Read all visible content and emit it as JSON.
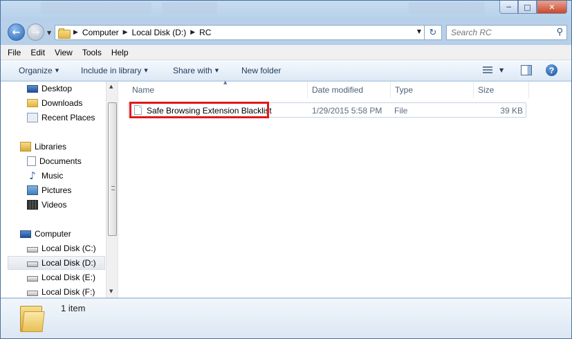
{
  "window": {
    "minimize": "─",
    "maximize": "□",
    "close": "✕"
  },
  "nav": {
    "back_icon": "arrow-left-icon",
    "forward_icon": "arrow-right-icon",
    "breadcrumb": [
      "Computer",
      "Local Disk (D:)",
      "RC"
    ],
    "search_placeholder": "Search RC"
  },
  "menu": [
    "File",
    "Edit",
    "View",
    "Tools",
    "Help"
  ],
  "toolbar": {
    "organize": "Organize",
    "include_in_library": "Include in library",
    "share_with": "Share with",
    "new_folder": "New folder"
  },
  "sidebar": {
    "favorites": [
      {
        "label": "Desktop",
        "icon": "desktop-icon"
      },
      {
        "label": "Downloads",
        "icon": "downloads-folder-icon"
      },
      {
        "label": "Recent Places",
        "icon": "recent-places-icon"
      }
    ],
    "libraries_label": "Libraries",
    "libraries": [
      {
        "label": "Documents",
        "icon": "documents-icon"
      },
      {
        "label": "Music",
        "icon": "music-icon"
      },
      {
        "label": "Pictures",
        "icon": "pictures-icon"
      },
      {
        "label": "Videos",
        "icon": "videos-icon"
      }
    ],
    "computer_label": "Computer",
    "drives": [
      {
        "label": "Local Disk (C:)"
      },
      {
        "label": "Local Disk (D:)",
        "selected": true
      },
      {
        "label": "Local Disk (E:)"
      },
      {
        "label": "Local Disk (F:)"
      }
    ]
  },
  "columns": {
    "name": "Name",
    "date_modified": "Date modified",
    "type": "Type",
    "size": "Size"
  },
  "files": [
    {
      "name": "Safe Browsing Extension Blacklist",
      "date_modified": "1/29/2015 5:58 PM",
      "type": "File",
      "size": "39 KB"
    }
  ],
  "details": {
    "item_count": "1 item"
  },
  "colors": {
    "highlight_box": "#e01919",
    "frame": "#b9d1ea"
  }
}
